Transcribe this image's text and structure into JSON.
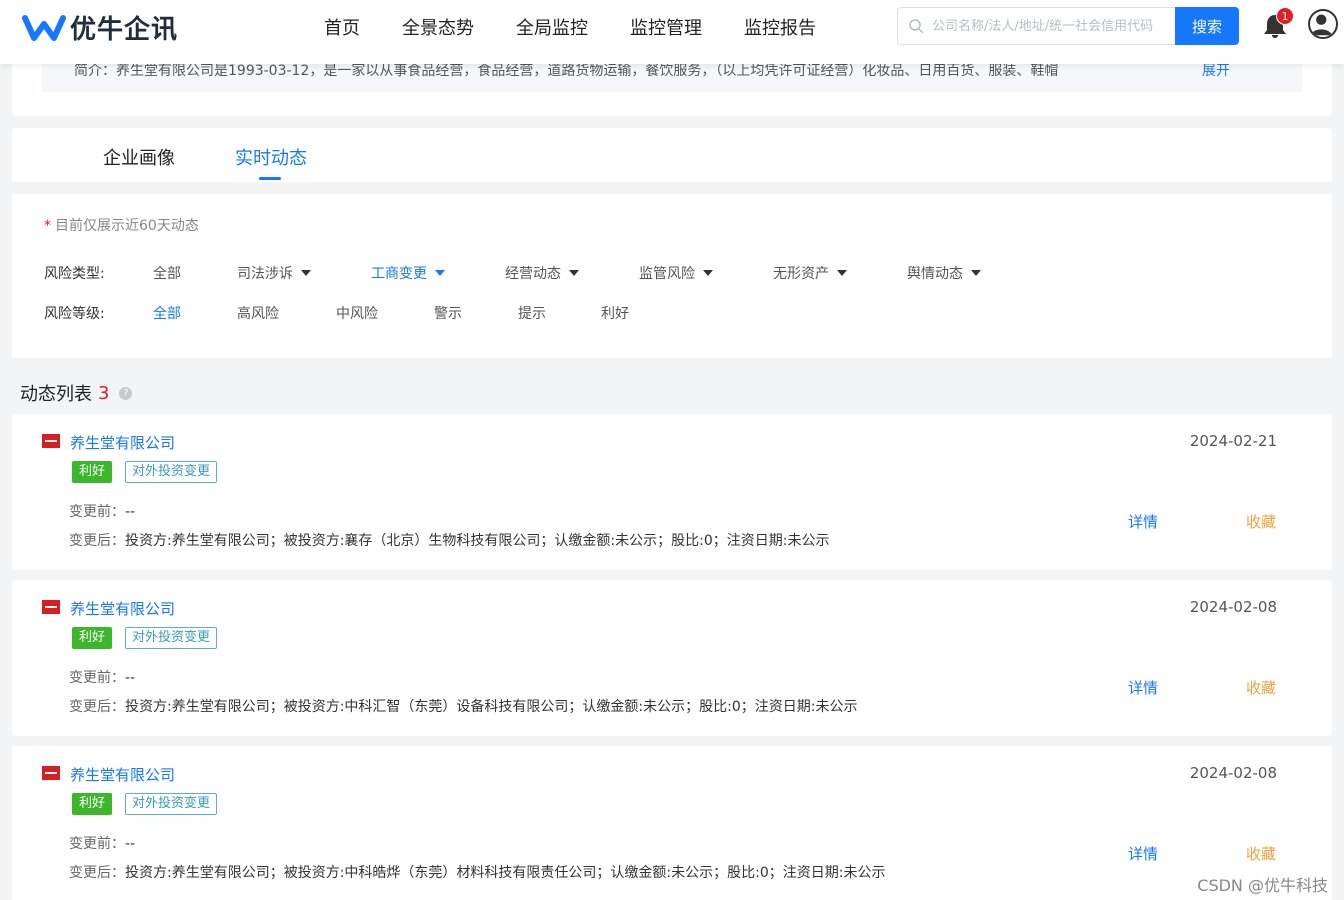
{
  "header": {
    "logo_text": "优牛企讯",
    "nav": [
      "首页",
      "全景态势",
      "全局监控",
      "监控管理",
      "监控报告"
    ],
    "search_placeholder": "公司名称/法人/地址/统一社会信用代码",
    "search_button": "搜索",
    "notification_count": "1",
    "brand_color": "#1677ff"
  },
  "intro": {
    "text": "简介：养生堂有限公司是1993-03-12，是一家以从事食品经营，食品经营，道路货物运输，餐饮服务，（以上均凭许可证经营）化妆品、日用百货、服装、鞋帽",
    "more_label": "展开"
  },
  "tabs": {
    "portrait": "企业画像",
    "realtime": "实时动态"
  },
  "filters": {
    "note_star": "*",
    "note": "目前仅展示近60天动态",
    "risk_type_label": "风险类型:",
    "risk_types": [
      {
        "label": "全部"
      },
      {
        "label": "司法涉诉"
      },
      {
        "label": "工商变更"
      },
      {
        "label": "经营动态"
      },
      {
        "label": "监管风险"
      },
      {
        "label": "无形资产"
      },
      {
        "label": "舆情动态"
      }
    ],
    "risk_level_label": "风险等级:",
    "risk_levels": [
      {
        "label": "全部"
      },
      {
        "label": "高风险"
      },
      {
        "label": "中风险"
      },
      {
        "label": "警示"
      },
      {
        "label": "提示"
      },
      {
        "label": "利好"
      }
    ]
  },
  "list": {
    "title": "动态列表",
    "count": "3",
    "help": "?",
    "detail_label": "详情",
    "fav_label": "收藏",
    "before_label": "变更前：",
    "after_label": "变更后：",
    "items": [
      {
        "company": "养生堂有限公司",
        "date": "2024-02-21",
        "tag_good": "利好",
        "tag_type": "对外投资变更",
        "before": "--",
        "after": "投资方:养生堂有限公司；被投资方:襄存（北京）生物科技有限公司；认缴金额:未公示；股比:0；注资日期:未公示"
      },
      {
        "company": "养生堂有限公司",
        "date": "2024-02-08",
        "tag_good": "利好",
        "tag_type": "对外投资变更",
        "before": "--",
        "after": "投资方:养生堂有限公司；被投资方:中科汇智（东莞）设备科技有限公司；认缴金额:未公示；股比:0；注资日期:未公示"
      },
      {
        "company": "养生堂有限公司",
        "date": "2024-02-08",
        "tag_good": "利好",
        "tag_type": "对外投资变更",
        "before": "--",
        "after": "投资方:养生堂有限公司；被投资方:中科皓烨（东莞）材料科技有限责任公司；认缴金额:未公示；股比:0；注资日期:未公示"
      }
    ]
  },
  "watermark": "CSDN @优牛科技"
}
